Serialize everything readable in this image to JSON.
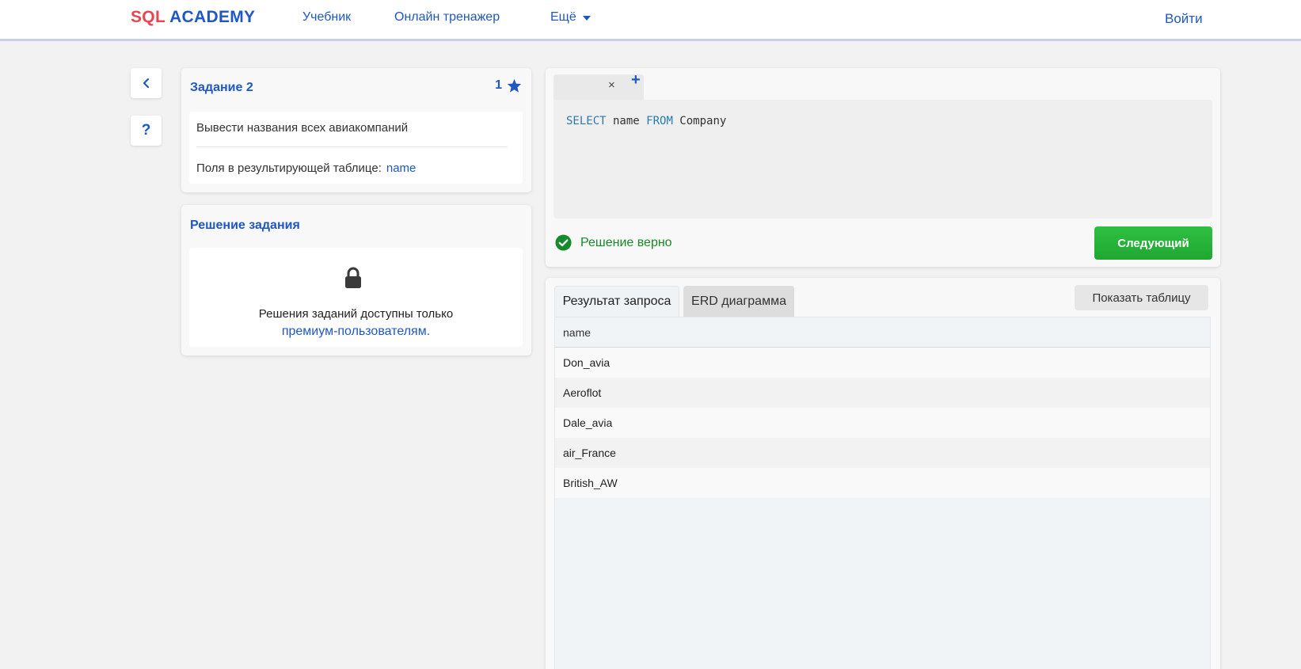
{
  "header": {
    "logo_sql": "SQL",
    "logo_academy": "ACADEMY",
    "nav": {
      "tutorial": "Учебник",
      "trainer": "Онлайн тренажер",
      "more": "Ещё"
    },
    "login": "Войти",
    "accent": "#1f57c3",
    "logo_red": "#e8454f"
  },
  "side": {
    "back_icon": "chevron-left-icon",
    "help_label": "?"
  },
  "task": {
    "title": "Задание 2",
    "score": "1",
    "score_icon": "star-icon",
    "description": "Вывести названия всех авиакомпаний",
    "fields_label": "Поля в результирующей таблице:",
    "fields_value": "name"
  },
  "solution": {
    "title": "Решение задания",
    "lock_icon": "lock-icon",
    "text": "Решения заданий доступны только",
    "link": "премиум-пользователям."
  },
  "editor": {
    "tab_close": "×",
    "tab_add": "+",
    "code": {
      "kw1": "SELECT",
      "part1": " name ",
      "kw2": "FROM",
      "part2": " Company"
    },
    "status": "Решение верно",
    "status_color": "#168b29",
    "next_button": "Следующий",
    "next_color": "#24ad37"
  },
  "results": {
    "tabs": [
      "Результат запроса",
      "ERD диаграмма"
    ],
    "show_table": "Показать таблицу",
    "columns": [
      "name"
    ],
    "rows": [
      "Don_avia",
      "Aeroflot",
      "Dale_avia",
      "air_France",
      "British_AW"
    ]
  }
}
